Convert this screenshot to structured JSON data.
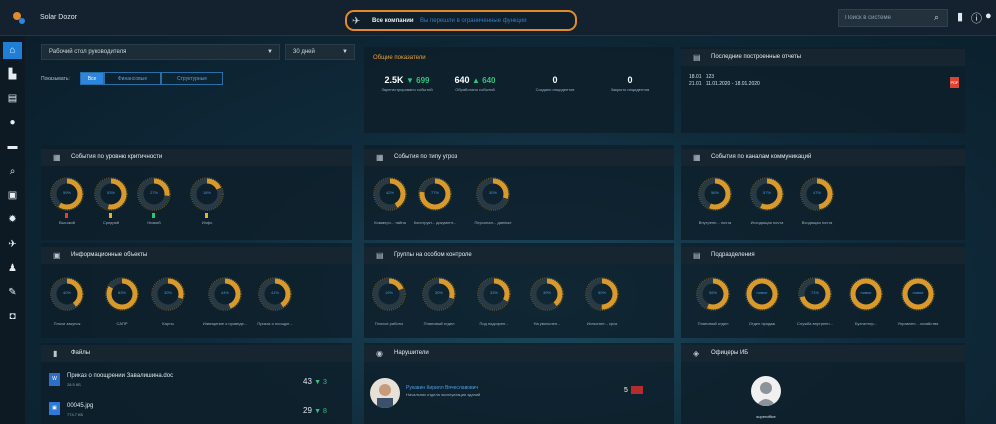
{
  "app": {
    "title": "Solar Dozor"
  },
  "company": {
    "name": "Все компании",
    "link": "Вы перешли в ограниченные функции"
  },
  "search": {
    "placeholder": "Поиск в системе"
  },
  "colors": {
    "accent": "#2c86e0",
    "orange": "#e58a2a",
    "green": "#30c37a",
    "red": "#e0442f"
  },
  "sidebar": {
    "items": [
      {
        "icon": "home-icon",
        "active": true
      },
      {
        "icon": "building-icon"
      },
      {
        "icon": "id-card-icon"
      },
      {
        "icon": "globe-icon"
      },
      {
        "icon": "monitor-icon"
      },
      {
        "icon": "search-icon"
      },
      {
        "icon": "mail-icon"
      },
      {
        "icon": "settings-icon"
      },
      {
        "icon": "plane-icon"
      },
      {
        "icon": "user-icon"
      },
      {
        "icon": "feather-icon"
      },
      {
        "icon": "box-icon"
      }
    ]
  },
  "dashboard": {
    "selector": "Рабочий стол руководителя",
    "period": "30 дней",
    "filter_label": "Показывать:",
    "filters": [
      "Все",
      "Финансовые",
      "Структурные"
    ],
    "active_filter": 0
  },
  "kpis": {
    "title": "Общие показатели",
    "items": [
      {
        "value": "2.5K",
        "delta": "▼ 699",
        "label": "Зарегистрировано событий"
      },
      {
        "value": "640",
        "delta": "▲ 640",
        "label": "Обработано событий"
      },
      {
        "value": "0",
        "delta": "",
        "label": "Создано инцидентов"
      },
      {
        "value": "0",
        "delta": "",
        "label": "Закрыто инцидентов"
      }
    ]
  },
  "reports": {
    "title": "Последние построенные отчеты",
    "rows": [
      {
        "date": "18.01",
        "name": "123"
      },
      {
        "date": "21.01",
        "name": "11.01.2020 - 18.01.2020"
      }
    ]
  },
  "panels": {
    "severity": {
      "title": "События по уровню критичности",
      "donuts": [
        {
          "pct": "59%",
          "value": 0.59,
          "label": "Высокий",
          "marker": "#e0442f"
        },
        {
          "pct": "53%",
          "value": 0.53,
          "label": "Средний",
          "marker": "#e5b12a"
        },
        {
          "pct": "27%",
          "value": 0.27,
          "label": "Низкий",
          "marker": "#30c37a"
        },
        {
          "pct": "18%",
          "value": 0.18,
          "label": "Инфо",
          "marker": "#e5b12a"
        }
      ]
    },
    "threats": {
      "title": "События по типу угроз",
      "donuts": [
        {
          "pct": "42%",
          "value": 0.42,
          "label": "Коммерч... тайна"
        },
        {
          "pct": "77%",
          "value": 0.77,
          "label": "Конструкт... документ..."
        },
        {
          "pct": "30%",
          "value": 0.3,
          "label": "Персонал... данные"
        }
      ]
    },
    "channels": {
      "title": "События по каналам коммуникаций",
      "donuts": [
        {
          "pct": "56%",
          "value": 0.56,
          "label": "Внутренн... почта"
        },
        {
          "pct": "57%",
          "value": 0.57,
          "label": "Исходящая почта"
        },
        {
          "pct": "47%",
          "value": 0.47,
          "label": "Входящая почта"
        }
      ]
    },
    "info_objects": {
      "title": "Информационные объекты",
      "donuts": [
        {
          "pct": "40%",
          "value": 0.4,
          "label": "Плохи закупок"
        },
        {
          "pct": "83%",
          "value": 0.83,
          "label": "САПР"
        },
        {
          "pct": "30%",
          "value": 0.3,
          "label": "Карты"
        },
        {
          "pct": "44%",
          "value": 0.44,
          "label": "Извещение о проведе..."
        },
        {
          "pct": "41%",
          "value": 0.41,
          "label": "Приказ о поощре..."
        }
      ]
    },
    "groups": {
      "title": "Группы на особом контроле",
      "donuts": [
        {
          "pct": "19%",
          "value": 0.19,
          "label": "Плохое работы"
        },
        {
          "pct": "30%",
          "value": 0.3,
          "label": "Плановый отдел"
        },
        {
          "pct": "33%",
          "value": 0.33,
          "label": "Под подозрен..."
        },
        {
          "pct": "39%",
          "value": 0.39,
          "label": "На увольнен..."
        },
        {
          "pct": "50%",
          "value": 0.5,
          "label": "Испытате... срок"
        }
      ]
    },
    "departments": {
      "title": "Подразделения",
      "donuts": [
        {
          "pct": "56%",
          "value": 0.56,
          "label": "Плановый отдел"
        },
        {
          "pct": "новое",
          "value": 1.0,
          "label": "Отдел продаж"
        },
        {
          "pct": "71%",
          "value": 0.71,
          "label": "Служба внутренн..."
        },
        {
          "pct": "новое",
          "value": 1.0,
          "label": "Бухгалтер..."
        },
        {
          "pct": "новое",
          "value": 1.0,
          "label": "Управлен... хозяйства"
        }
      ]
    },
    "files": {
      "title": "Файлы",
      "rows": [
        {
          "name": "Приказ о поощрении Завалишина.doc",
          "size": "28.5 КБ",
          "count": "43",
          "delta": "▼ 3"
        },
        {
          "name": "00045.jpg",
          "size": "774.7 КБ",
          "count": "29",
          "delta": "▼ 8"
        }
      ]
    },
    "violators": {
      "title": "Нарушители",
      "person": {
        "name": "Рукавин Кирилл Вячеславович",
        "role": "Начальник отдела эксплуатации зданий",
        "count": "5"
      }
    },
    "officers": {
      "title": "Офицеры ИБ",
      "person": {
        "name": "superoffice"
      }
    }
  }
}
